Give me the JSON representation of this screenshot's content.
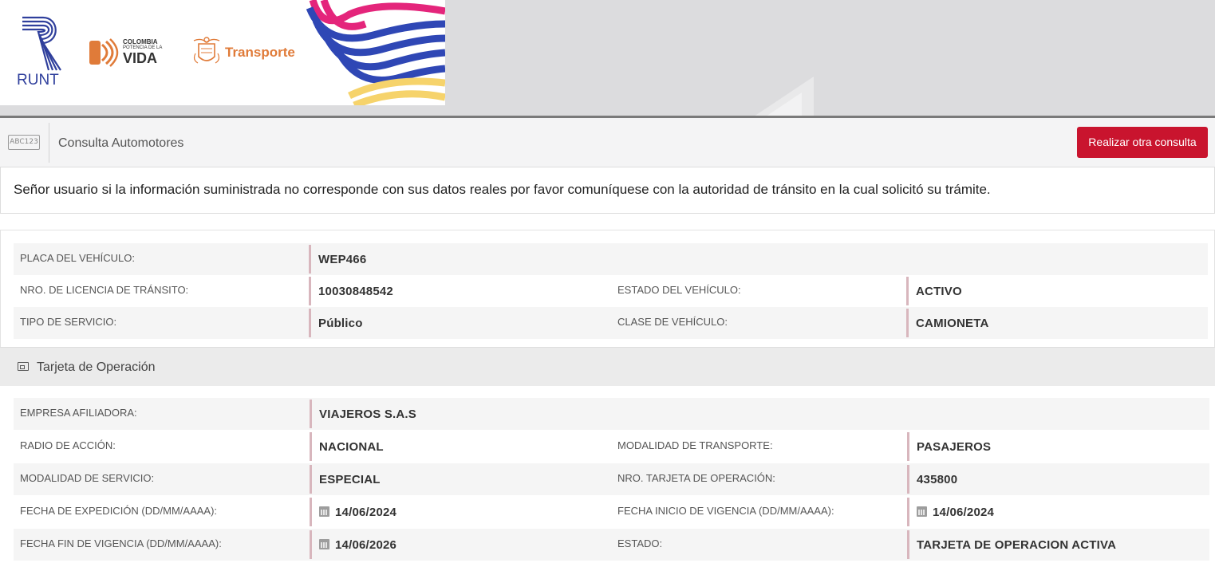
{
  "header": {
    "runt_text": "RUNT",
    "colombia_line1": "COLOMBIA",
    "colombia_line2": "POTENCIA DE LA",
    "colombia_line3": "VIDA",
    "transporte": "Transporte",
    "colors": {
      "runt_blue": "#2f3f9c",
      "transporte_orange": "#e07b39",
      "ribbon_pink": "#e4257b",
      "ribbon_blue": "#2f47b5",
      "ribbon_yellow": "#f6d36b"
    }
  },
  "toolbar": {
    "icon_text": "ABC123",
    "title": "Consulta Automotores",
    "button": "Realizar otra consulta",
    "button_color": "#c9142e"
  },
  "notice": "Señor usuario si la información suministrada no corresponde con sus datos reales por favor comuníquese con la autoridad de tránsito en la cual solicitó su trámite.",
  "vehiculo": {
    "placa_label": "PLACA DEL VEHÍCULO:",
    "placa": "WEP466",
    "licencia_label": "NRO. DE LICENCIA DE TRÁNSITO:",
    "licencia": "10030848542",
    "estado_label": "ESTADO DEL VEHÍCULO:",
    "estado": "ACTIVO",
    "servicio_label": "TIPO DE SERVICIO:",
    "servicio": "Público",
    "clase_label": "CLASE DE VEHÍCULO:",
    "clase": "CAMIONETA"
  },
  "tarjeta": {
    "section_title": "Tarjeta de Operación",
    "empresa_label": "EMPRESA AFILIADORA:",
    "empresa": "VIAJEROS S.A.S",
    "radio_label": "RADIO DE ACCIÓN:",
    "radio": "NACIONAL",
    "modalidad_transporte_label": "MODALIDAD DE TRANSPORTE:",
    "modalidad_transporte": "PASAJEROS",
    "modalidad_servicio_label": "MODALIDAD DE SERVICIO:",
    "modalidad_servicio": "ESPECIAL",
    "nro_tarjeta_label": "NRO. TARJETA DE OPERACIÓN:",
    "nro_tarjeta": "435800",
    "fecha_expedicion_label": "FECHA DE EXPEDICIÓN (DD/MM/AAAA):",
    "fecha_expedicion": "14/06/2024",
    "fecha_inicio_label": "FECHA INICIO DE VIGENCIA (DD/MM/AAAA):",
    "fecha_inicio": "14/06/2024",
    "fecha_fin_label": "FECHA FIN DE VIGENCIA (DD/MM/AAAA):",
    "fecha_fin": "14/06/2026",
    "estado_label": "ESTADO:",
    "estado": "TARJETA DE OPERACION ACTIVA"
  }
}
